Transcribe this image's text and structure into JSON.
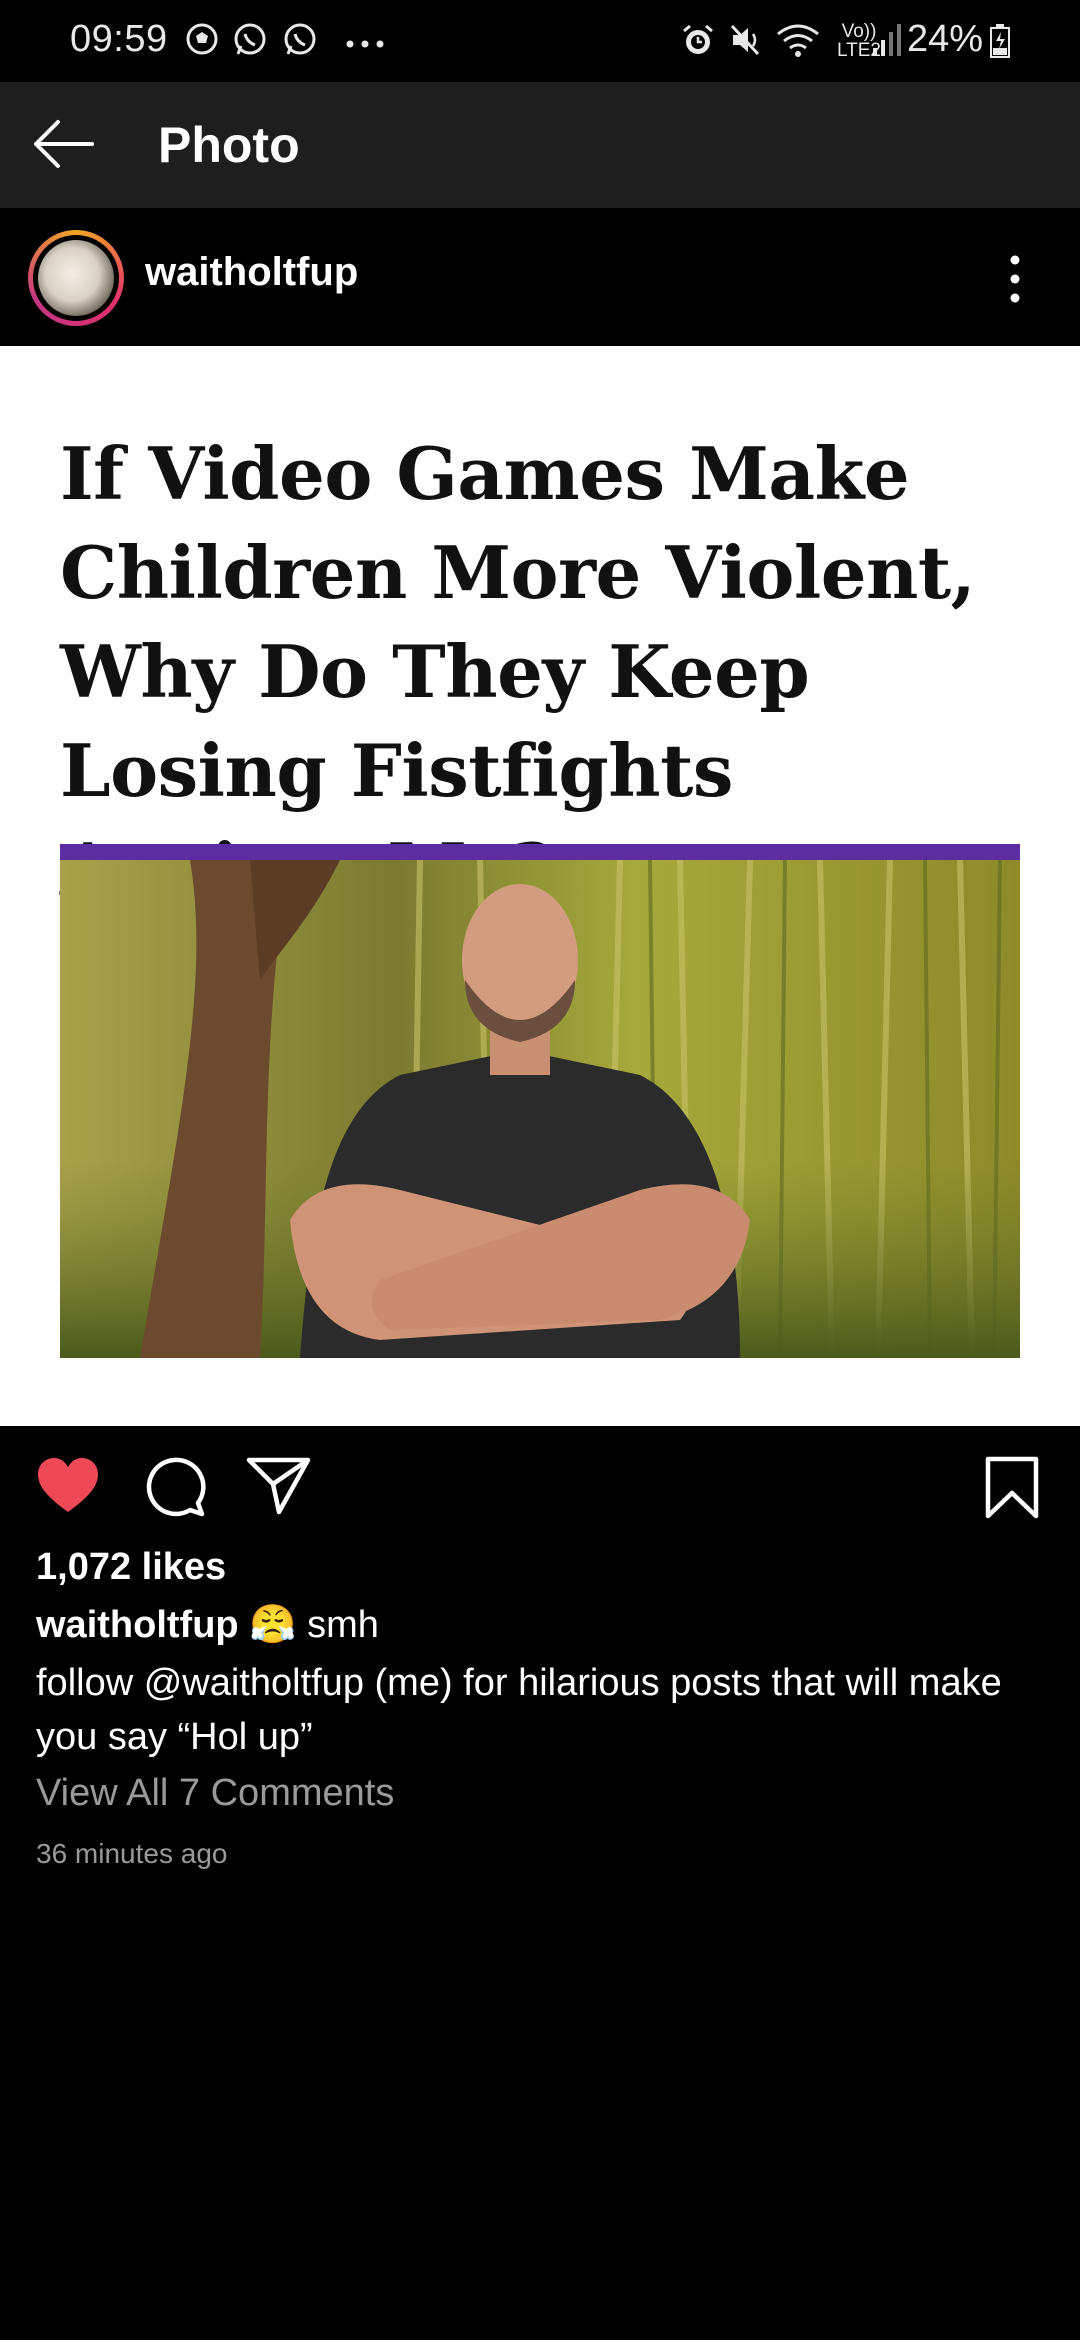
{
  "status_bar": {
    "time": "09:59",
    "network": "LTE2",
    "volte": "Vo))",
    "battery": "24%",
    "left_icons": [
      "soccer-ball-icon",
      "whatsapp-icon",
      "whatsapp-icon",
      "more-notifications-icon"
    ],
    "right_icons": [
      "alarm-icon",
      "mute-icon",
      "wifi-icon",
      "signal-icon",
      "battery-charging-icon"
    ]
  },
  "app_bar": {
    "title": "Photo",
    "back_icon": "back-arrow-icon"
  },
  "post": {
    "username": "waitholtfup",
    "image": {
      "headline": "If Video Games Make Children More Violent, Why Do They Keep Losing Fistfights Against Me?",
      "accent_color": "#5b2d9e"
    },
    "likes": "1,072 likes",
    "caption": {
      "username": "waitholtfup",
      "emoji": "😤",
      "text": "smh",
      "line2": "follow @waitholtfup (me) for hilarious posts that will make you say “Hol up”"
    },
    "view_comments": "View All 7 Comments",
    "time_ago": "36 minutes ago",
    "like_color": "#ed4956"
  }
}
